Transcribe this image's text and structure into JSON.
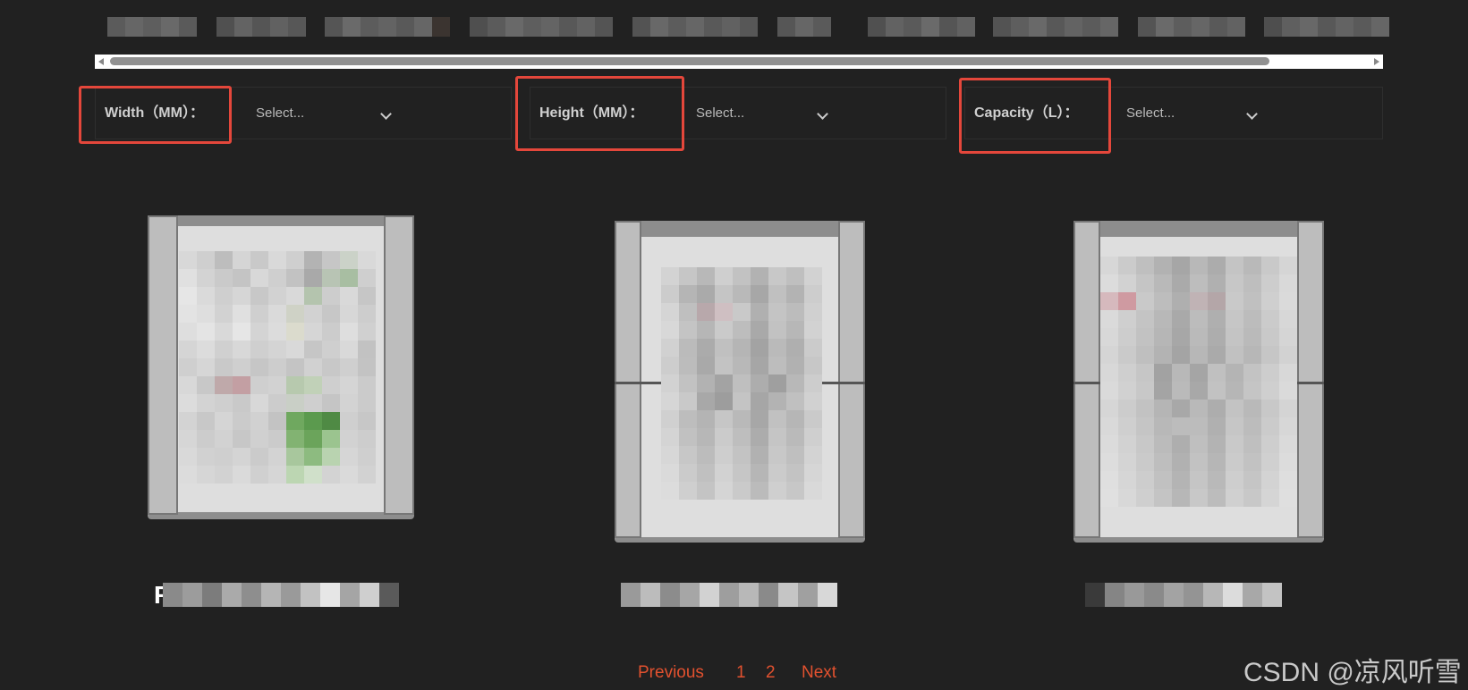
{
  "filters": [
    {
      "label": "Width（MM）：",
      "placeholder": "Select..."
    },
    {
      "label": "Height（MM）：",
      "placeholder": "Select..."
    },
    {
      "label": "Capacity（L）：",
      "placeholder": "Select..."
    }
  ],
  "pagination": {
    "previous": "Previous",
    "pages": [
      "1",
      "2"
    ],
    "next": "Next"
  },
  "watermark": "CSDN @凉风听雪",
  "colors": {
    "background": "#212121",
    "accent": "#e2512f",
    "highlight_box": "#e4473b"
  },
  "icons": [
    "chevron-down-icon",
    "scroll-left-arrow-icon",
    "scroll-right-arrow-icon"
  ]
}
